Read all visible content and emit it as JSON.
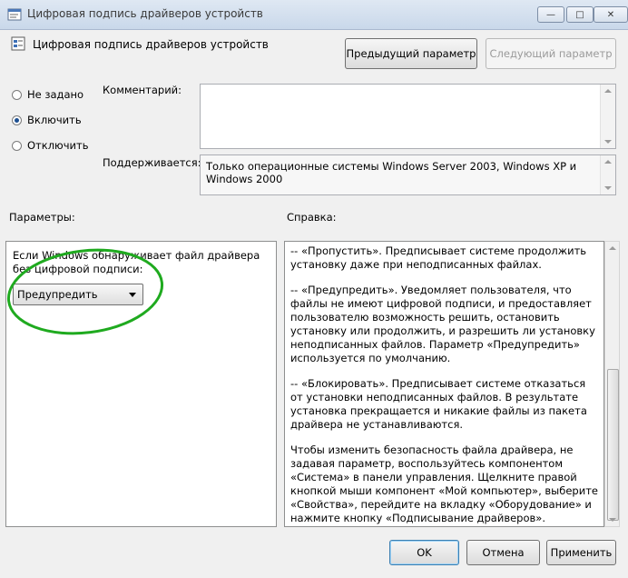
{
  "window": {
    "title": "Цифровая подпись драйверов устройств",
    "minimize_glyph": "—",
    "maximize_glyph": "□",
    "close_glyph": "✕"
  },
  "header": {
    "policy_title": "Цифровая подпись драйверов устройств",
    "prev_label": "Предыдущий параметр",
    "next_label": "Следующий параметр"
  },
  "state": {
    "options": [
      {
        "label": "Не задано",
        "selected": false
      },
      {
        "label": "Включить",
        "selected": true
      },
      {
        "label": "Отключить",
        "selected": false
      }
    ]
  },
  "comment": {
    "label": "Комментарий:",
    "value": ""
  },
  "supported": {
    "label": "Поддерживается:",
    "value": "Только операционные системы Windows Server 2003, Windows XP и Windows 2000"
  },
  "sections": {
    "params_label": "Параметры:",
    "help_label": "Справка:"
  },
  "params": {
    "description": "Если Windows обнаруживает файл драйвера без цифровой подписи:",
    "dropdown_value": "Предупредить"
  },
  "help": {
    "paragraphs": [
      "--   «Пропустить». Предписывает системе продолжить установку даже при неподписанных файлах.",
      "--   «Предупредить». Уведомляет пользователя, что файлы не имеют цифровой подписи, и предоставляет пользователю возможность решить, остановить установку или продолжить, и разрешить ли установку неподписанных файлов. Параметр «Предупредить» используется по умолчанию.",
      "--   «Блокировать». Предписывает системе отказаться от установки неподписанных файлов. В результате установка прекращается и никакие файлы из пакета драйвера не устанавливаются.",
      "Чтобы изменить безопасность файла драйвера, не задавая параметр, воспользуйтесь компонентом «Система» в панели управления. Щелкните правой кнопкой мыши компонент «Мой компьютер», выберите «Свойства», перейдите на вкладку «Оборудование» и нажмите кнопку «Подписывание драйверов»."
    ]
  },
  "footer": {
    "ok_label": "OK",
    "cancel_label": "Отмена",
    "apply_label": "Применить"
  },
  "colors": {
    "highlight_circle": "#1faa1f",
    "window_bg": "#f0f0f0"
  }
}
